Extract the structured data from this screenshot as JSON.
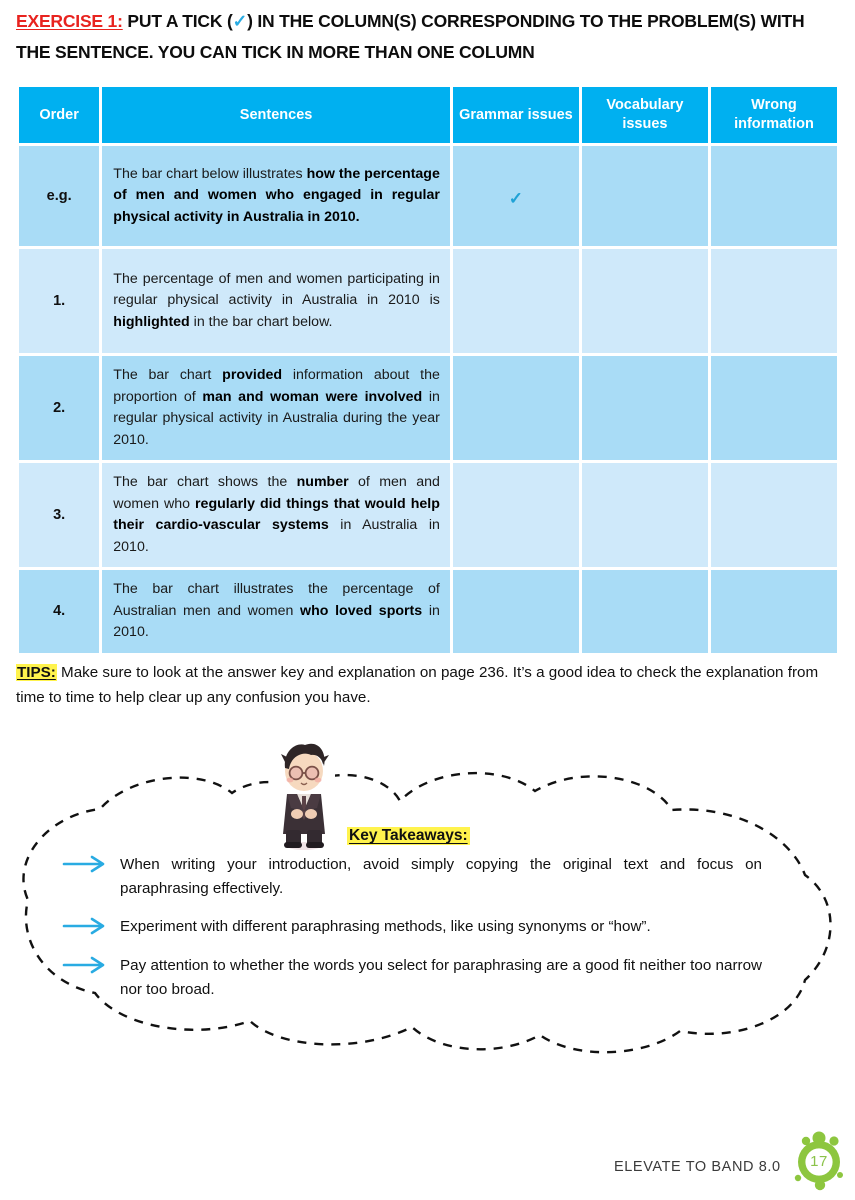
{
  "heading": {
    "label": "EXERCISE 1:",
    "tick_glyph": "✓",
    "text_before_tick": "PUT A TICK (",
    "text_after_tick": ") IN THE COLUMN(S) CORRESPONDING TO THE PROBLEM(S) WITH THE SENTENCE. YOU CAN TICK IN MORE THAN ONE COLUMN"
  },
  "table": {
    "headers": {
      "order": "Order",
      "sentences": "Sentences",
      "grammar": "Grammar issues",
      "vocabulary": "Vocabulary issues",
      "wrong": "Wrong information"
    },
    "tick_glyph": "✓",
    "rows": [
      {
        "order": "e.g.",
        "parts": [
          {
            "text": "The bar chart below illustrates ",
            "bold": false
          },
          {
            "text": "how the percentage of men and women who engaged in regular physical activity in Australia in 2010.",
            "bold": true
          }
        ],
        "grammar": true,
        "vocabulary": false,
        "wrong": false
      },
      {
        "order": "1.",
        "parts": [
          {
            "text": "The percentage of men and women participating in regular physical activity in Australia in 2010 is ",
            "bold": false
          },
          {
            "text": "highlighted",
            "bold": true
          },
          {
            "text": " in the bar chart below.",
            "bold": false
          }
        ],
        "grammar": false,
        "vocabulary": false,
        "wrong": false
      },
      {
        "order": "2.",
        "parts": [
          {
            "text": "The bar chart ",
            "bold": false
          },
          {
            "text": "provided",
            "bold": true
          },
          {
            "text": " information about the proportion of ",
            "bold": false
          },
          {
            "text": "man and woman were involved",
            "bold": true
          },
          {
            "text": " in regular physical activity in Australia during the year 2010.",
            "bold": false
          }
        ],
        "grammar": false,
        "vocabulary": false,
        "wrong": false
      },
      {
        "order": "3.",
        "parts": [
          {
            "text": "The bar chart shows the ",
            "bold": false
          },
          {
            "text": "number",
            "bold": true
          },
          {
            "text": " of men and women who ",
            "bold": false
          },
          {
            "text": "regularly did things that would help their cardio-vascular systems",
            "bold": true
          },
          {
            "text": " in Australia in 2010.",
            "bold": false
          }
        ],
        "grammar": false,
        "vocabulary": false,
        "wrong": false
      },
      {
        "order": "4.",
        "parts": [
          {
            "text": "The bar chart illustrates the percentage of Australian men and women ",
            "bold": false
          },
          {
            "text": "who loved sports",
            "bold": true
          },
          {
            "text": " in 2010.",
            "bold": false
          }
        ],
        "grammar": false,
        "vocabulary": false,
        "wrong": false
      }
    ]
  },
  "tips": {
    "label": "TIPS:",
    "text": " Make sure to look at the answer key and explanation on page 236. It’s a good idea to check the explanation from time to time to help clear up any confusion you have."
  },
  "takeaways": {
    "title": "Key Takeaways:",
    "bullets": [
      "When writing your introduction, avoid simply copying the original text and focus on paraphrasing effectively.",
      "Experiment with different paraphrasing methods, like using synonyms or “how”.",
      "Pay attention to whether the words you select for paraphrasing are a good fit neither too narrow nor too broad."
    ]
  },
  "footer": {
    "brand": "ELEVATE TO BAND 8.0",
    "page_number": "17"
  },
  "colors": {
    "header_cyan": "#00b0f0",
    "cell_blue_dark": "#a9dcf6",
    "cell_blue_light": "#cfe9fa",
    "accent_red": "#e8231f",
    "highlight_yellow": "#fff34d",
    "arrow_blue": "#29abe2",
    "footer_green": "#8bc34a"
  }
}
